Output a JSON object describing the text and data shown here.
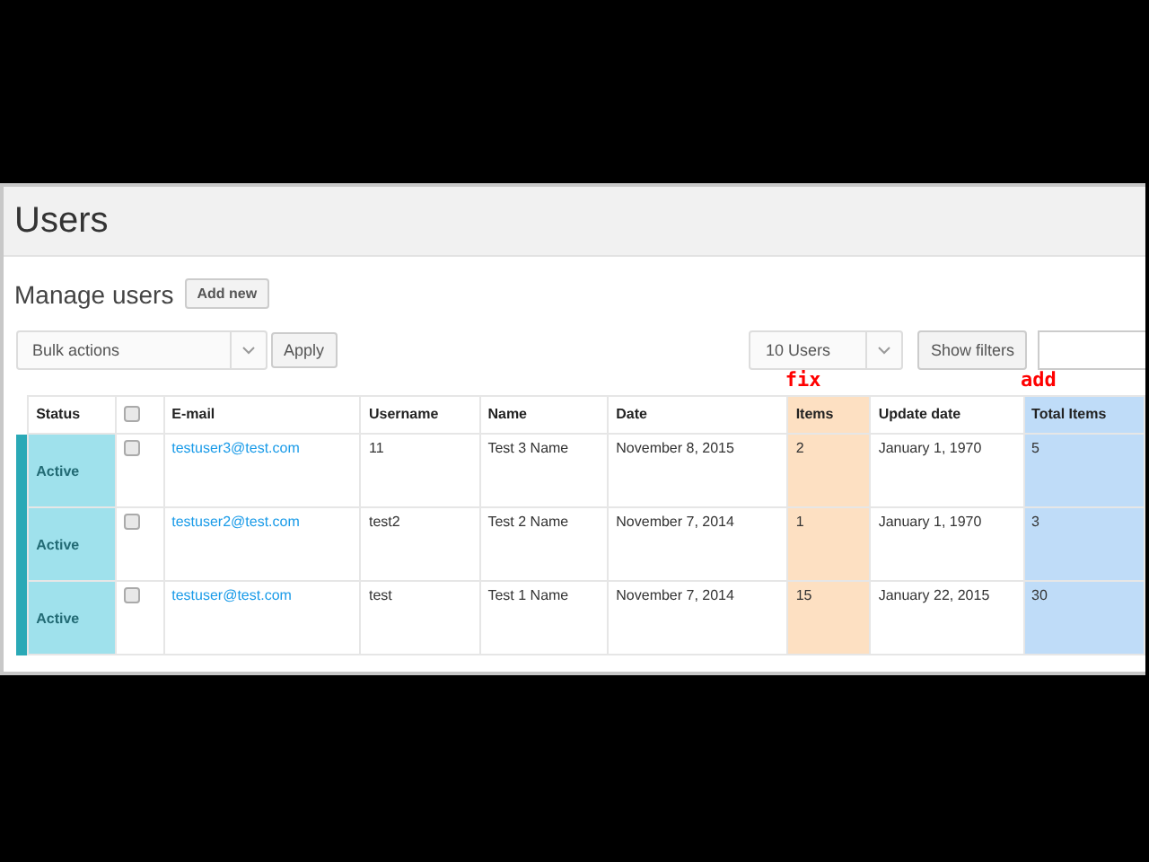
{
  "page": {
    "title": "Users"
  },
  "section": {
    "title": "Manage users",
    "add_button": "Add new"
  },
  "toolbar": {
    "bulk_actions": "Bulk actions",
    "apply": "Apply",
    "per_page": "10 Users",
    "show_filters": "Show filters"
  },
  "table": {
    "select_all": {
      "checked": false
    },
    "columns": [
      {
        "label": "Status",
        "kind": "status"
      },
      {
        "label": "E-mail",
        "kind": "link"
      },
      {
        "label": "Username",
        "kind": "text"
      },
      {
        "label": "Name",
        "kind": "text"
      },
      {
        "label": "Date",
        "kind": "text"
      },
      {
        "label": "Items",
        "kind": "text",
        "annotation": "fix",
        "color": "#fde0c2"
      },
      {
        "label": "Update date",
        "kind": "text"
      },
      {
        "label": "Total Items",
        "kind": "text",
        "annotation": "add",
        "color": "#bfdcf8"
      }
    ],
    "rows": [
      {
        "checked": false,
        "cells": [
          "Active",
          "testuser3@test.com",
          "11",
          "Test 3 Name",
          "November 8, 2015",
          "2",
          "January 1, 1970",
          "5"
        ]
      },
      {
        "checked": false,
        "cells": [
          "Active",
          "testuser2@test.com",
          "test2",
          "Test 2 Name",
          "November 7, 2014",
          "1",
          "January 1, 1970",
          "3"
        ]
      },
      {
        "checked": false,
        "cells": [
          "Active",
          "testuser@test.com",
          "test",
          "Test 1 Name",
          "November 7, 2014",
          "15",
          "January 22, 2015",
          "30"
        ]
      }
    ]
  }
}
